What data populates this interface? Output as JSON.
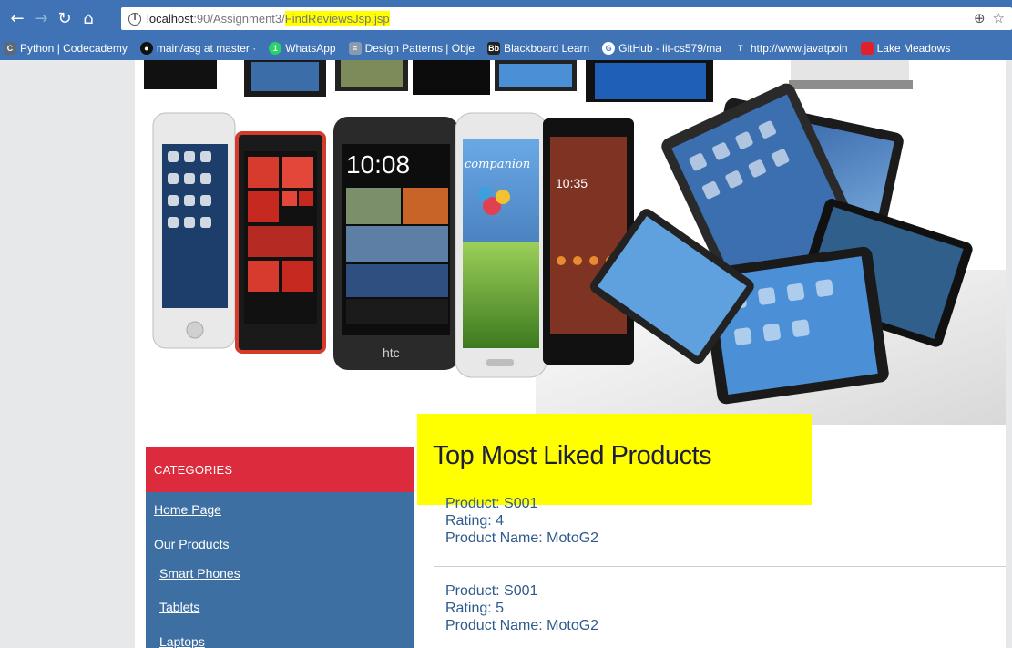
{
  "browser": {
    "url_host": "localhost",
    "url_path": ":90/Assignment3/",
    "url_highlight": "FindReviewsJsp.jsp",
    "bookmarks": [
      {
        "label": "Python | Codecademy",
        "icon": "codecademy-icon",
        "color": "#555555"
      },
      {
        "label": "main/asg at master · ",
        "icon": "github-icon",
        "color": "#111111"
      },
      {
        "label": "WhatsApp",
        "icon": "whatsapp-icon",
        "color": "#25d366"
      },
      {
        "label": "Design Patterns | Obje",
        "icon": "doc-icon",
        "color": "#8a9bb0"
      },
      {
        "label": "Blackboard Learn",
        "icon": "blackboard-icon",
        "color": "#222222"
      },
      {
        "label": "GitHub - iit-cs579/ma",
        "icon": "google-icon",
        "color": "#ffffff"
      },
      {
        "label": "http://www.javatpoin",
        "icon": "javatpoint-icon",
        "color": "#3f73b5"
      },
      {
        "label": "Lake Meadows",
        "icon": "bookmark-red-icon",
        "color": "#e0202a"
      }
    ]
  },
  "sidebar": {
    "heading": "CATEGORIES",
    "home": "Home Page",
    "our_products": "Our Products",
    "smart_phones": "Smart Phones",
    "tablets": "Tablets",
    "laptops": "Laptops"
  },
  "main": {
    "title": "Top Most Liked Products",
    "reviews": [
      {
        "product": "Product: S001",
        "rating": "Rating: 4",
        "name": "Product Name: MotoG2"
      },
      {
        "product": "Product: S001",
        "rating": "Rating: 5",
        "name": "Product Name: MotoG2"
      }
    ]
  },
  "banner": {
    "phone_time": "10:08",
    "phone_brand": "htc",
    "galaxy_text": "companion",
    "sony_time": "10:35"
  },
  "colors": {
    "chrome": "#3f73b5",
    "category_header": "#dc2b3c",
    "sidebar": "#3e6fa3",
    "highlight": "#ffff00",
    "review_text": "#2e5a8c"
  }
}
